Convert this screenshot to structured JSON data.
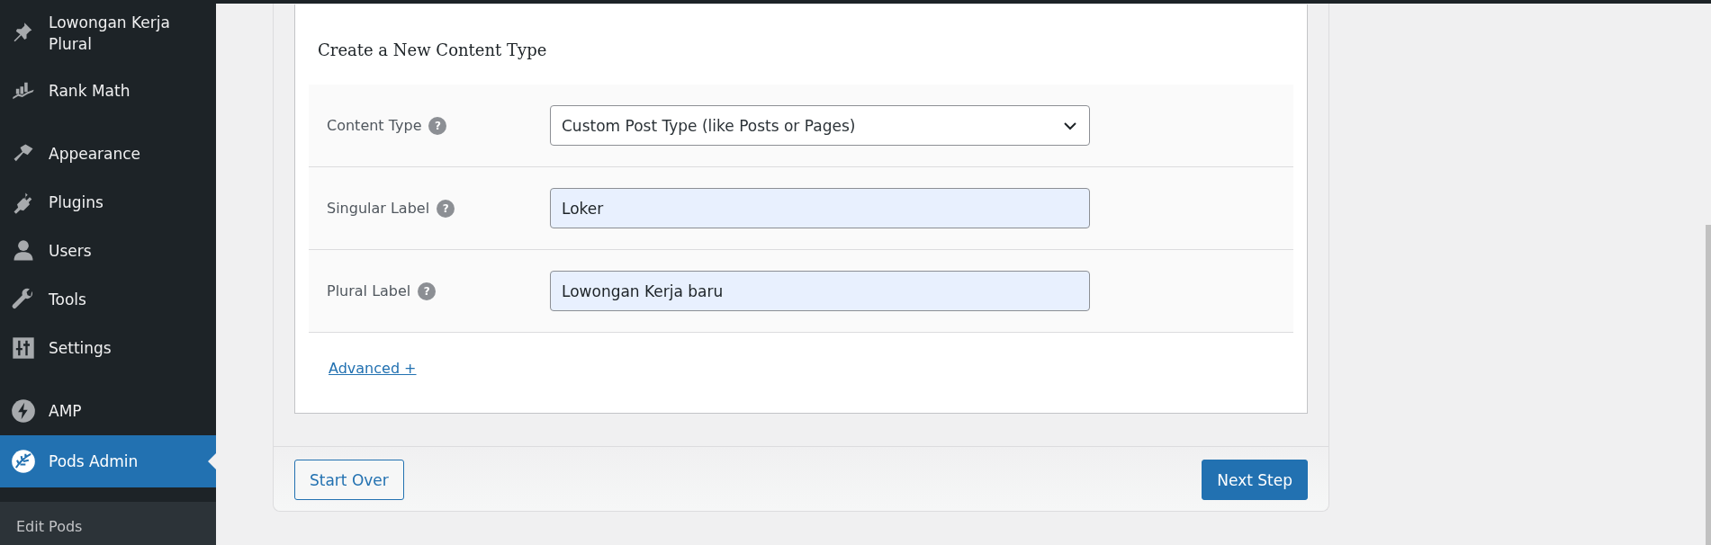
{
  "sidebar": {
    "groups": [
      {
        "items": [
          {
            "label": "Lowongan Kerja Plural",
            "selected": false
          },
          {
            "label": "Rank Math",
            "selected": false
          }
        ]
      },
      {
        "items": [
          {
            "label": "Appearance",
            "selected": false
          },
          {
            "label": "Plugins",
            "selected": false
          },
          {
            "label": "Users",
            "selected": false
          },
          {
            "label": "Tools",
            "selected": false
          },
          {
            "label": "Settings",
            "selected": false
          }
        ]
      },
      {
        "items": [
          {
            "label": "AMP",
            "selected": false
          },
          {
            "label": "Pods Admin",
            "selected": true
          }
        ]
      }
    ],
    "submenu": [
      {
        "label": "Edit Pods",
        "selected": false
      }
    ]
  },
  "form": {
    "title": "Create a New Content Type",
    "fields": [
      {
        "kind": "select",
        "label": "Content Type",
        "help": "?",
        "value": "Custom Post Type (like Posts or Pages)"
      },
      {
        "kind": "text",
        "label": "Singular Label",
        "help": "?",
        "value": "Loker"
      },
      {
        "kind": "text",
        "label": "Plural Label",
        "help": "?",
        "value": "Lowongan Kerja baru"
      }
    ],
    "advanced_link": "Advanced +"
  },
  "footer": {
    "secondary_button": "Start Over",
    "primary_button": "Next Step"
  }
}
